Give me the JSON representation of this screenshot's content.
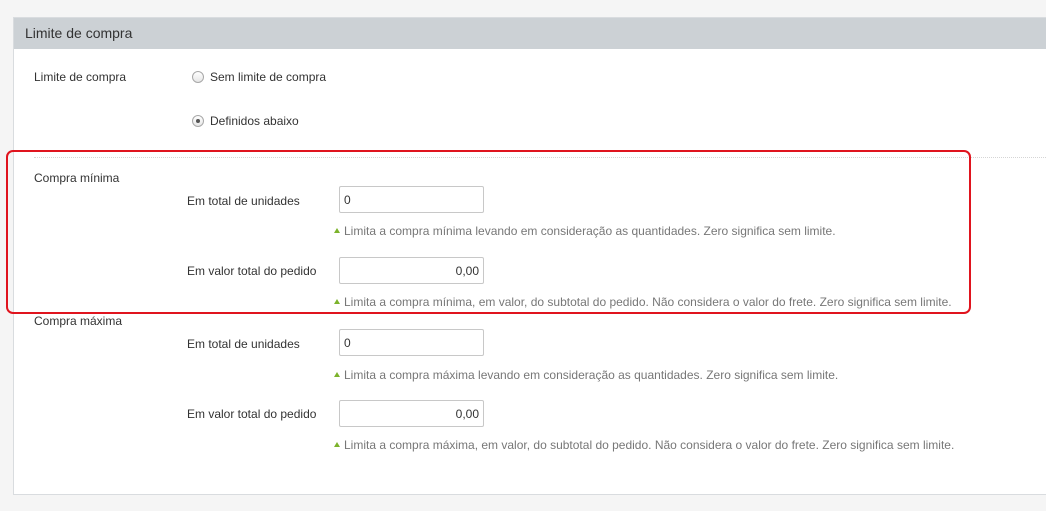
{
  "panel": {
    "title": "Limite de compra"
  },
  "limit": {
    "label": "Limite de compra",
    "options": [
      {
        "label": "Sem limite de compra",
        "checked": false
      },
      {
        "label": "Definidos abaixo",
        "checked": true
      }
    ]
  },
  "min": {
    "section_label": "Compra mínima",
    "units_label": "Em total de unidades",
    "units_value": "0",
    "units_hint": "Limita a compra mínima levando em consideração as quantidades. Zero significa sem limite.",
    "value_label": "Em valor total do pedido",
    "value_value": "0,00",
    "value_hint": "Limita a compra mínima, em valor, do subtotal do pedido. Não considera o valor do frete. Zero significa sem limite."
  },
  "max": {
    "section_label": "Compra máxima",
    "units_label": "Em total de unidades",
    "units_value": "0",
    "units_hint": "Limita a compra máxima levando em consideração as quantidades. Zero significa sem limite.",
    "value_label": "Em valor total do pedido",
    "value_value": "0,00",
    "value_hint": "Limita a compra máxima, em valor, do subtotal do pedido. Não considera o valor do frete. Zero significa sem limite."
  },
  "colors": {
    "header_bg": "#ccd1d5",
    "highlight": "#e0141e",
    "hint_arrow": "#7cb32b"
  },
  "icons": {
    "hint": "triangle-up-icon"
  }
}
